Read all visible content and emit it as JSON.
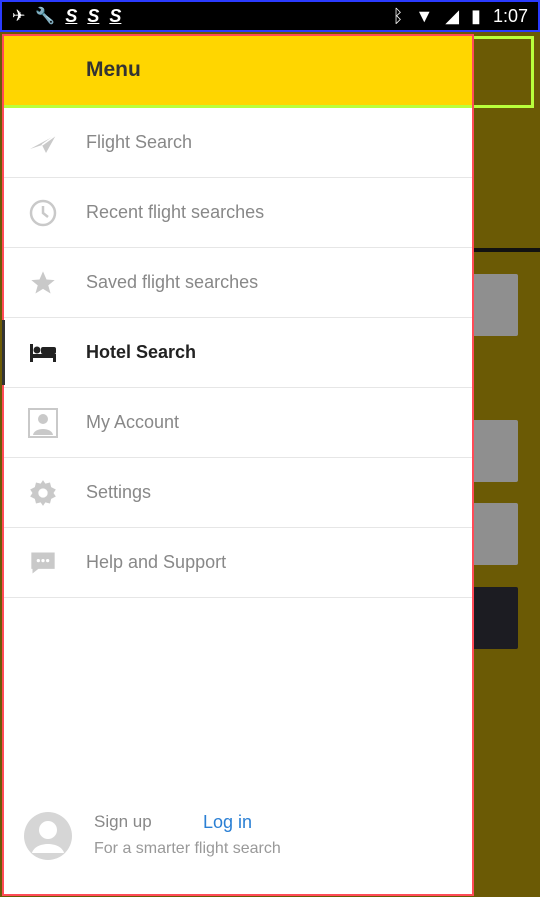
{
  "status_bar": {
    "time": "1:07",
    "left_glyphs": [
      "S",
      "S",
      "S"
    ]
  },
  "drawer": {
    "title": "Menu",
    "items": [
      {
        "label": "Flight Search",
        "icon": "plane-icon",
        "active": false
      },
      {
        "label": "Recent flight searches",
        "icon": "history-clock-icon",
        "active": false
      },
      {
        "label": "Saved flight searches",
        "icon": "star-icon",
        "active": false
      },
      {
        "label": "Hotel Search",
        "icon": "bed-icon",
        "active": true
      },
      {
        "label": "My Account",
        "icon": "person-icon",
        "active": false
      },
      {
        "label": "Settings",
        "icon": "gear-icon",
        "active": false
      },
      {
        "label": "Help and Support",
        "icon": "chat-bubble-icon",
        "active": false
      }
    ],
    "footer": {
      "sign_up": "Sign up",
      "login": "Log in",
      "tagline": "For a smarter flight search"
    }
  },
  "colors": {
    "header": "#ffd600",
    "link": "#2a7fd4",
    "scrim": "#6b5a05"
  }
}
